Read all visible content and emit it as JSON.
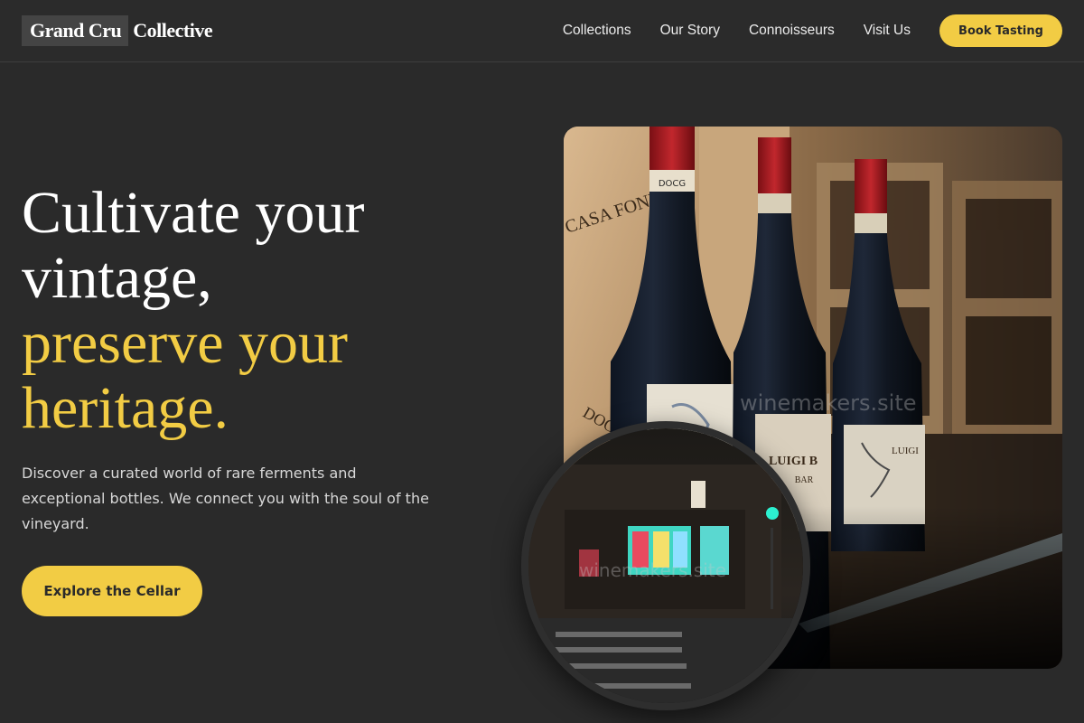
{
  "header": {
    "logo_part1": "Grand Cru",
    "logo_part2": "Collective",
    "nav": [
      "Collections",
      "Our Story",
      "Connoisseurs",
      "Visit Us"
    ],
    "book_label": "Book Tasting"
  },
  "hero": {
    "title_line1": "Cultivate your",
    "title_line2": "vintage,",
    "title_line3": "preserve your",
    "title_line4": "heritage.",
    "description": "Discover a curated world of rare ferments and exceptional bottles. We connect you with the soul of the vineyard.",
    "cta_label": "Explore the Cellar"
  },
  "images": {
    "main_watermark": "winemakers.site",
    "round_watermark": "winemakers.site",
    "crate_text": "CASA FONDA",
    "crate_text2": "DOC",
    "label_left": "DOCG",
    "label_middle": "LUIGI B",
    "label_middle_sub": "BAR",
    "label_right": "LUIGI"
  },
  "colors": {
    "background": "#2a2a2a",
    "accent": "#f2cc44",
    "text": "#ffffff"
  }
}
